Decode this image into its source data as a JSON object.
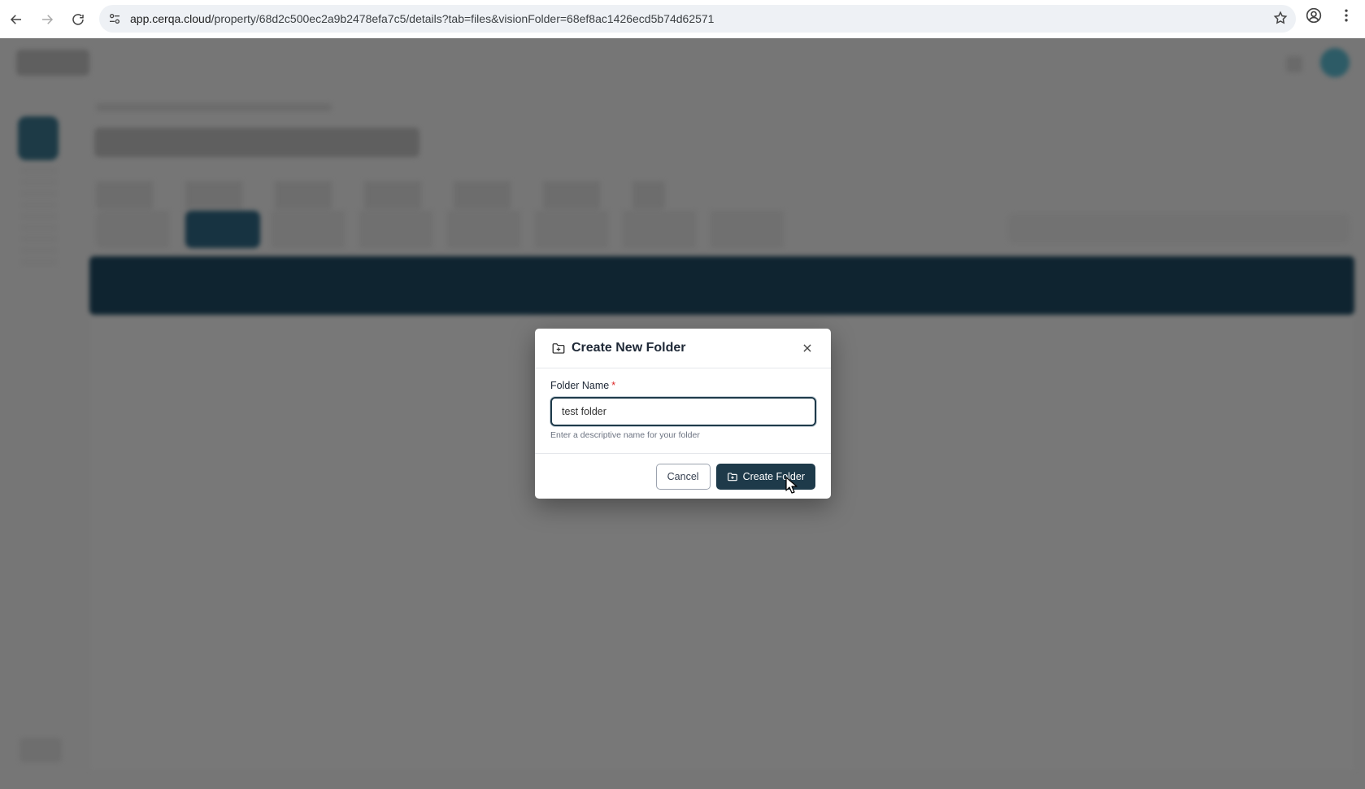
{
  "browser": {
    "url_host": "app.cerqa.cloud",
    "url_path": "/property/68d2c500ec2a9b2478efa7c5/details?tab=files&visionFolder=68ef8ac1426ecd5b74d62571"
  },
  "modal": {
    "title": "Create New Folder",
    "field_label": "Folder Name",
    "required_marker": "*",
    "input_value": "test folder",
    "helper_text": "Enter a descriptive name for your folder",
    "cancel_label": "Cancel",
    "create_label": "Create Folder"
  },
  "colors": {
    "primary": "#1e3a4a",
    "overlay": "#767676",
    "required": "#dc2626"
  }
}
